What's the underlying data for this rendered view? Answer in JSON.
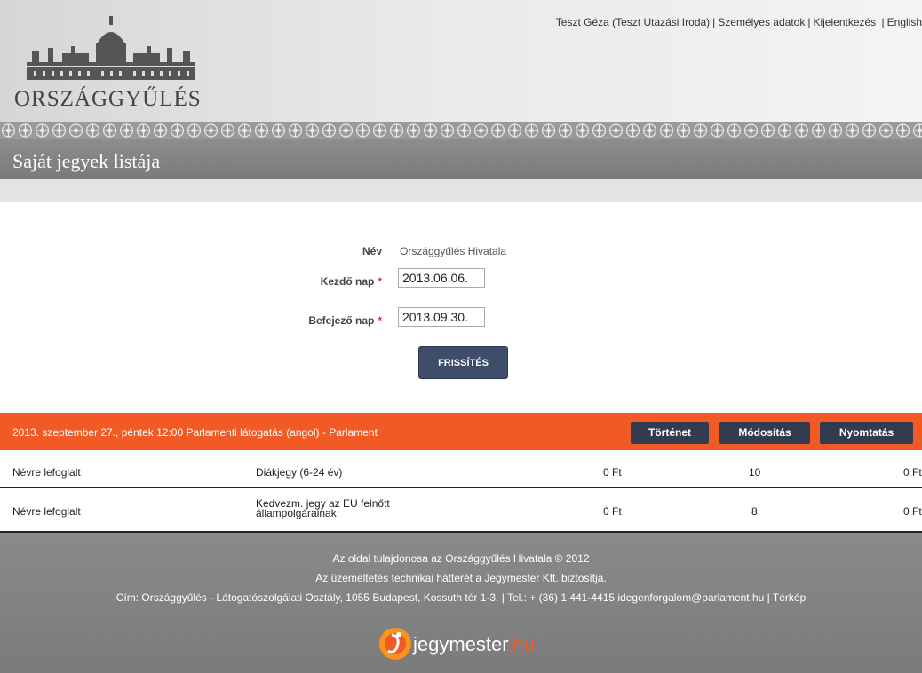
{
  "header": {
    "user": "Teszt Géza (Teszt Utazási Iroda)",
    "personal_data": "Személyes adatok",
    "logout": "Kijelentkezés",
    "language": "English",
    "logo_text": "ORSZÁGGYŰLÉS",
    "page_title": "Saját jegyek listája"
  },
  "form": {
    "name_label": "Név",
    "name_value": "Országgyűlés Hivatala",
    "start_label": "Kezdő nap",
    "start_value": "2013.06.06.",
    "end_label": "Befejező nap",
    "end_value": "2013.09.30.",
    "required_mark": "*",
    "refresh_label": "FRISSÍTÉS"
  },
  "event": {
    "title": "2013. szeptember 27., péntek 12:00 Parlamenti látogatás (angol) - Parlament",
    "history_label": "Történet",
    "modify_label": "Módosítás",
    "print_label": "Nyomtatás"
  },
  "tickets": [
    {
      "status": "Névre lefoglalt",
      "type": "Diákjegy (6-24 év)",
      "price": "0 Ft",
      "qty": "10",
      "total": "0 Ft"
    },
    {
      "status": "Névre lefoglalt",
      "type_line1": "Kedvezm. jegy az EU felnőtt",
      "type_line2": "állampolgárainak",
      "price": "0 Ft",
      "qty": "8",
      "total": "0 Ft"
    }
  ],
  "footer": {
    "line1": "Az oldal tulajdonosa az Országgyűlés Hivatala © 2012",
    "line2": "Az üzemeltetés technikai hátterét a Jegymester Kft. biztosítja.",
    "line3": "Cím: Országgyűlés - Látogatószolgálati Osztály, 1055 Budapest, Kossuth tér 1-3. | Tel.: + (36) 1 441-4415 idegenforgalom@parlament.hu | Térkép",
    "brand_main": "jegymester",
    "brand_tld": ".hu"
  },
  "colors": {
    "accent_orange": "#f15a24",
    "button_navy": "#333c4f",
    "footer_gray": "#808080"
  }
}
